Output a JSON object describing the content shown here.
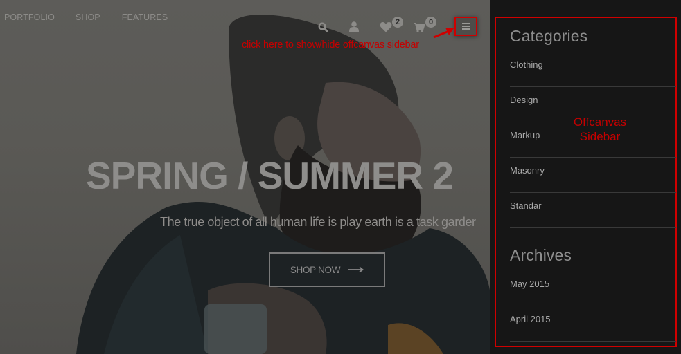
{
  "nav": {
    "items": [
      {
        "label": "PORTFOLIO"
      },
      {
        "label": "SHOP"
      },
      {
        "label": "FEATURES"
      }
    ]
  },
  "header_icons": {
    "search": {
      "icon": "search-icon"
    },
    "account": {
      "icon": "user-icon"
    },
    "wishlist": {
      "icon": "heart-icon",
      "count": "2"
    },
    "cart": {
      "icon": "cart-icon",
      "count": "0"
    },
    "menu": {
      "icon": "hamburger-icon"
    }
  },
  "annotations": {
    "menu_hint": "click here to show/hide offcanvas sidebar",
    "sidebar_label_line1": "Offcanvas",
    "sidebar_label_line2": "Sidebar",
    "annotation_color": "#cf0000"
  },
  "hero": {
    "headline": "SPRING / SUMMER 2",
    "subheadline": "The true object of all human life is play earth is a task garder",
    "cta_label": "SHOP NOW",
    "cta_icon": "long-arrow-right-icon"
  },
  "sidebar": {
    "widgets": [
      {
        "title": "Categories",
        "items": [
          {
            "label": "Clothing"
          },
          {
            "label": "Design"
          },
          {
            "label": "Markup"
          },
          {
            "label": "Masonry"
          },
          {
            "label": "Standar"
          }
        ]
      },
      {
        "title": "Archives",
        "items": [
          {
            "label": "May 2015"
          },
          {
            "label": "April 2015"
          }
        ]
      }
    ]
  }
}
